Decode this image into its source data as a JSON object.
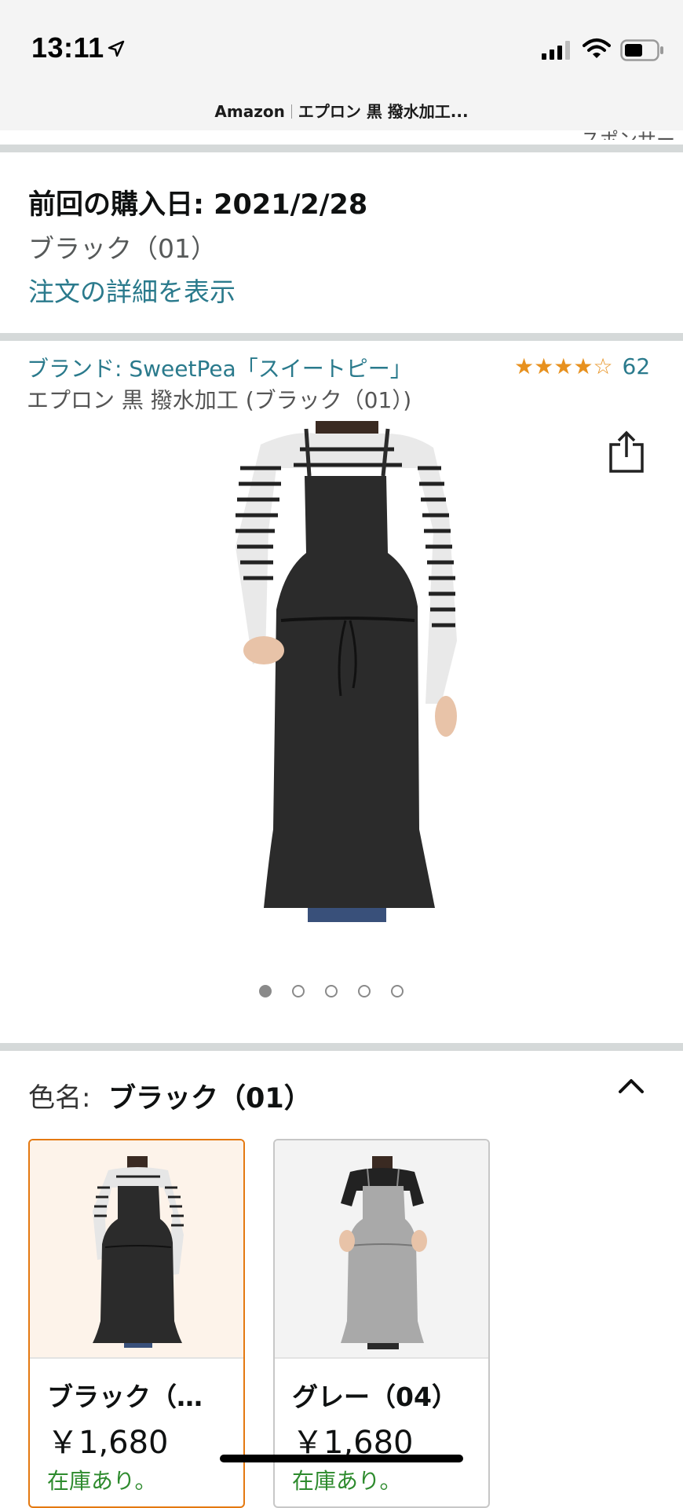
{
  "status_bar": {
    "time": "13:11",
    "location_icon": "location-arrow-icon",
    "signal_icon": "cellular-signal-icon",
    "wifi_icon": "wifi-icon",
    "battery_icon": "battery-icon"
  },
  "url_bar": {
    "site": "Amazon",
    "page_title": "エプロン 黒 撥水加工..."
  },
  "sponsored_cut": "スポンサー",
  "purchase": {
    "date_text": "前回の購入日: 2021/2/28",
    "variant": "ブラック（01）",
    "order_link": "注文の詳細を表示"
  },
  "product": {
    "brand_link": "ブランド: SweetPea「スイートピー」",
    "rating_stars": 4.5,
    "rating_count": "62",
    "title": "エプロン 黒 撥水加工 (ブラック（01）)",
    "share_icon": "share-icon",
    "image_dot_count": 5,
    "active_dot": 0
  },
  "variation": {
    "label": "色名:",
    "selected": "ブラック（01）",
    "collapse_icon": "chevron-up-icon",
    "swatches": [
      {
        "name": "ブラック（…",
        "price": "￥1,680",
        "stock": "在庫あり。",
        "apron_color": "#2b2b2b"
      },
      {
        "name": "グレー（04）",
        "price": "￥1,680",
        "stock": "在庫あり。",
        "apron_color": "#a9a9a9"
      }
    ]
  },
  "colors": {
    "link": "#2a7a8c",
    "star": "#e7911f",
    "in_stock": "#2e8b2e",
    "selected_border": "#e47911"
  }
}
